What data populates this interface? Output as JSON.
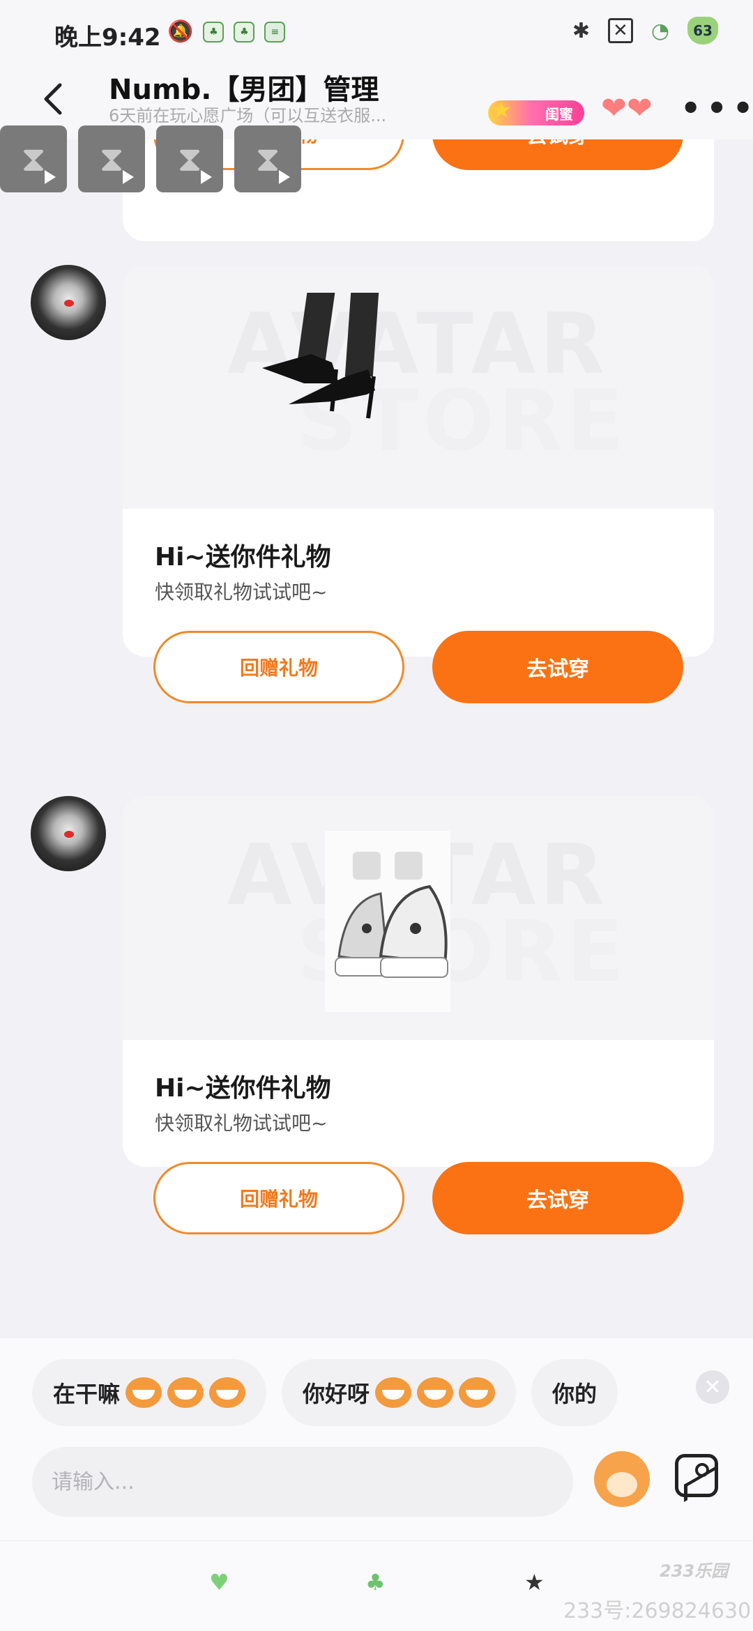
{
  "status_bar": {
    "time": "晚上9:42",
    "battery": "63"
  },
  "header": {
    "title": "Numb.【男团】管理",
    "subtitle": "6天前在玩心愿广场（可以互送衣服...",
    "badge": "闺蜜"
  },
  "cards": [
    {
      "title": "Hi~送你件礼物",
      "desc": "快领取礼物试试吧~",
      "return_label": "回赠礼物",
      "try_label": "去试穿",
      "item_icon": "high-heels"
    },
    {
      "title": "Hi~送你件礼物",
      "desc": "快领取礼物试试吧~",
      "return_label": "回赠礼物",
      "try_label": "去试穿",
      "item_icon": "sneakers"
    }
  ],
  "partial_card": {
    "return_label": "回赠礼物",
    "try_label": "去试穿"
  },
  "watermark": {
    "line1": "AVATAR",
    "line2": "STORE"
  },
  "quick_replies": [
    "在干嘛",
    "你好呀",
    "你的"
  ],
  "input": {
    "placeholder": "请输入..."
  },
  "footer": {
    "brand": "233乐园",
    "id_text": "233号:269824630"
  },
  "colors": {
    "accent": "#fa7214",
    "outline": "#f08a2a",
    "background": "#f2f2f6"
  }
}
